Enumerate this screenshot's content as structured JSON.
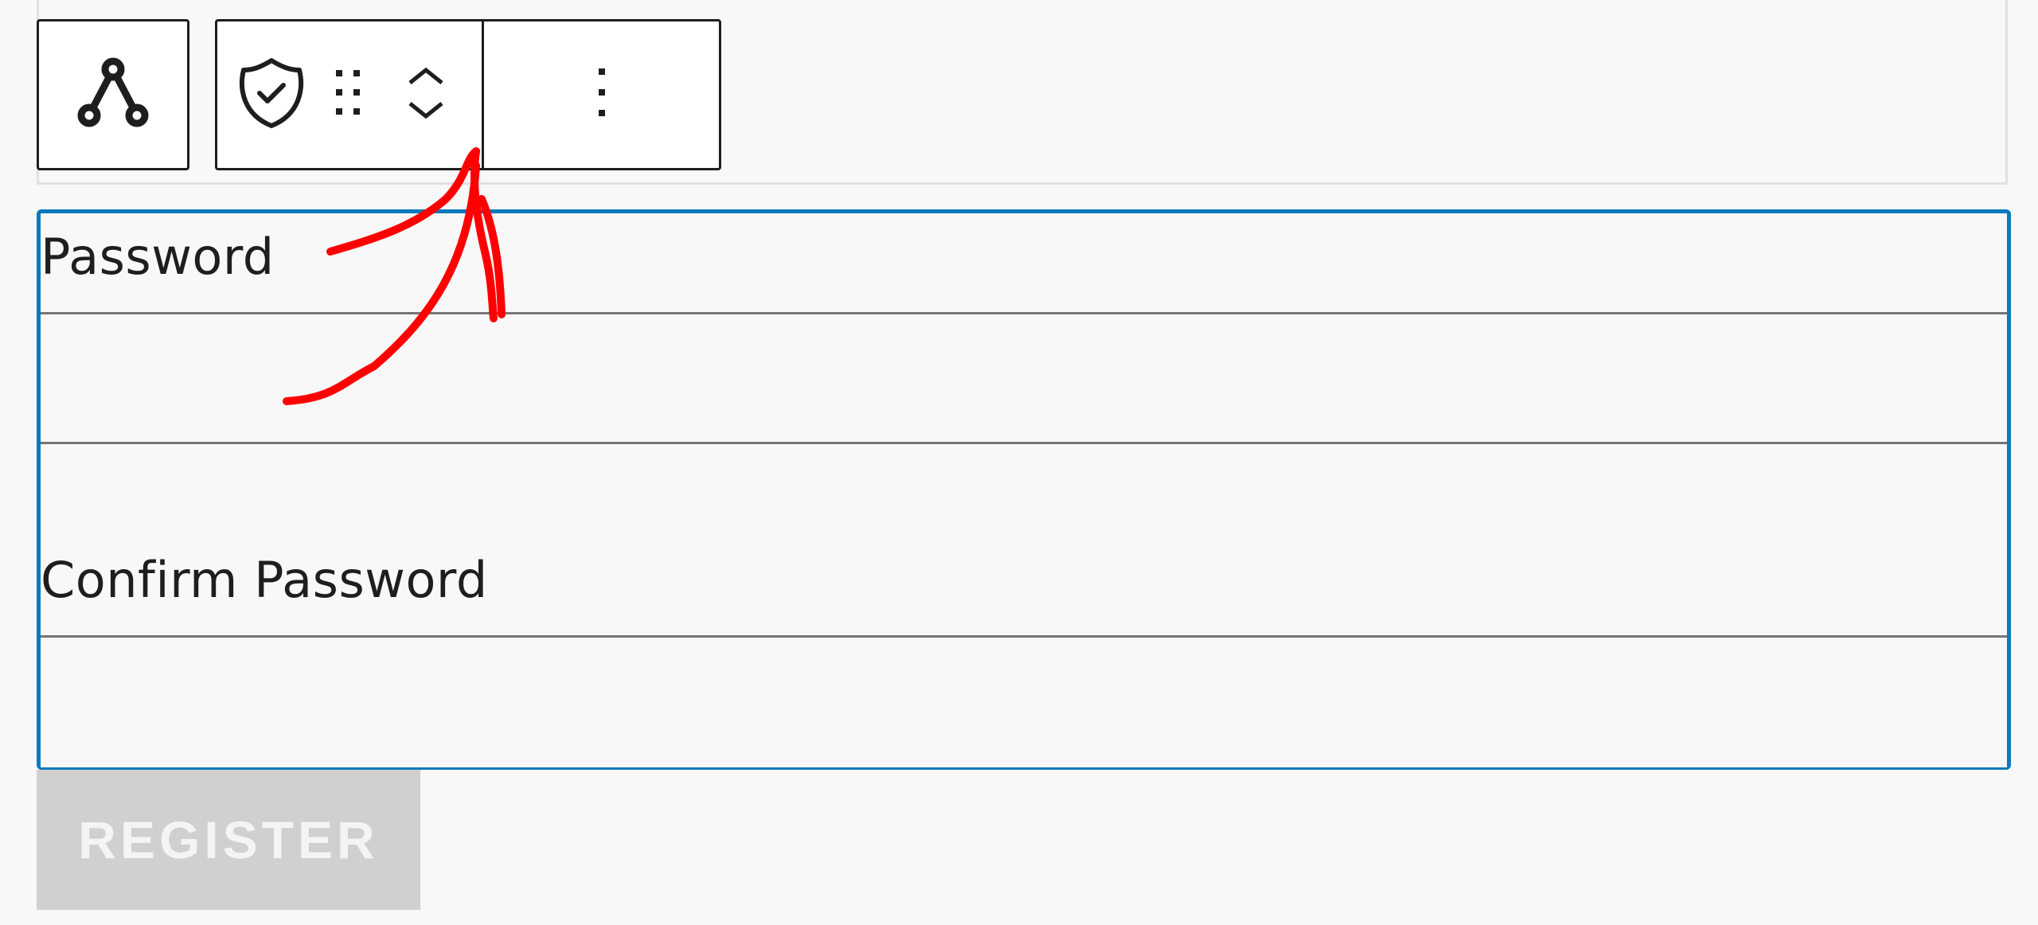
{
  "toolbar": {
    "parent_icon": "parent-block-icon",
    "block_type_icon": "shield-check-icon",
    "drag_icon": "drag-handle-icon",
    "move_up_icon": "chevron-up-icon",
    "move_down_icon": "chevron-down-icon",
    "more_icon": "more-vertical-icon"
  },
  "form": {
    "fields": [
      {
        "label": "Password",
        "value": ""
      },
      {
        "label": "Confirm Password",
        "value": ""
      }
    ],
    "submit_label": "REGISTER"
  },
  "colors": {
    "background": "#f8f8f8",
    "selection_border": "#0a7aba",
    "toolbar_border": "#1e1e1e",
    "button_disabled": "#d0d0d0",
    "annotation": "#ff0000"
  }
}
